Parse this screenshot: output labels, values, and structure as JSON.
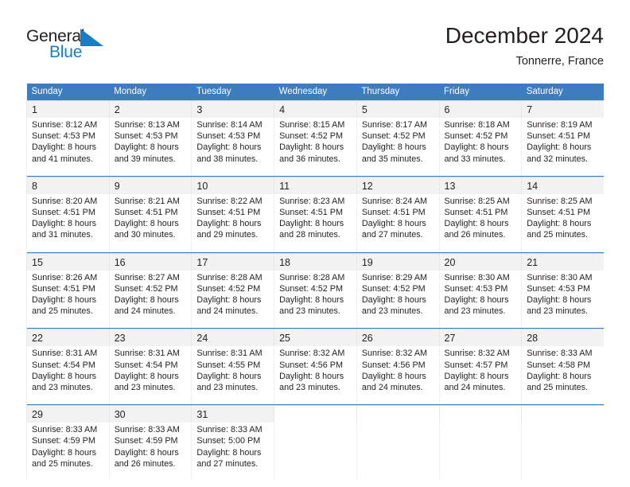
{
  "brand": {
    "name_part1": "General",
    "name_part2": "Blue",
    "flag_color": "#1a7dc4"
  },
  "header": {
    "title": "December 2024",
    "location": "Tonnerre, France"
  },
  "colors": {
    "header_blue": "#3b7dbf",
    "daynum_band": "#f2f2f2",
    "text": "#231f20"
  },
  "weekday_headers": [
    "Sunday",
    "Monday",
    "Tuesday",
    "Wednesday",
    "Thursday",
    "Friday",
    "Saturday"
  ],
  "weeks": [
    {
      "days": [
        {
          "num": "1",
          "sunrise": "Sunrise: 8:12 AM",
          "sunset": "Sunset: 4:53 PM",
          "daylight1": "Daylight: 8 hours",
          "daylight2": "and 41 minutes."
        },
        {
          "num": "2",
          "sunrise": "Sunrise: 8:13 AM",
          "sunset": "Sunset: 4:53 PM",
          "daylight1": "Daylight: 8 hours",
          "daylight2": "and 39 minutes."
        },
        {
          "num": "3",
          "sunrise": "Sunrise: 8:14 AM",
          "sunset": "Sunset: 4:53 PM",
          "daylight1": "Daylight: 8 hours",
          "daylight2": "and 38 minutes."
        },
        {
          "num": "4",
          "sunrise": "Sunrise: 8:15 AM",
          "sunset": "Sunset: 4:52 PM",
          "daylight1": "Daylight: 8 hours",
          "daylight2": "and 36 minutes."
        },
        {
          "num": "5",
          "sunrise": "Sunrise: 8:17 AM",
          "sunset": "Sunset: 4:52 PM",
          "daylight1": "Daylight: 8 hours",
          "daylight2": "and 35 minutes."
        },
        {
          "num": "6",
          "sunrise": "Sunrise: 8:18 AM",
          "sunset": "Sunset: 4:52 PM",
          "daylight1": "Daylight: 8 hours",
          "daylight2": "and 33 minutes."
        },
        {
          "num": "7",
          "sunrise": "Sunrise: 8:19 AM",
          "sunset": "Sunset: 4:51 PM",
          "daylight1": "Daylight: 8 hours",
          "daylight2": "and 32 minutes."
        }
      ]
    },
    {
      "days": [
        {
          "num": "8",
          "sunrise": "Sunrise: 8:20 AM",
          "sunset": "Sunset: 4:51 PM",
          "daylight1": "Daylight: 8 hours",
          "daylight2": "and 31 minutes."
        },
        {
          "num": "9",
          "sunrise": "Sunrise: 8:21 AM",
          "sunset": "Sunset: 4:51 PM",
          "daylight1": "Daylight: 8 hours",
          "daylight2": "and 30 minutes."
        },
        {
          "num": "10",
          "sunrise": "Sunrise: 8:22 AM",
          "sunset": "Sunset: 4:51 PM",
          "daylight1": "Daylight: 8 hours",
          "daylight2": "and 29 minutes."
        },
        {
          "num": "11",
          "sunrise": "Sunrise: 8:23 AM",
          "sunset": "Sunset: 4:51 PM",
          "daylight1": "Daylight: 8 hours",
          "daylight2": "and 28 minutes."
        },
        {
          "num": "12",
          "sunrise": "Sunrise: 8:24 AM",
          "sunset": "Sunset: 4:51 PM",
          "daylight1": "Daylight: 8 hours",
          "daylight2": "and 27 minutes."
        },
        {
          "num": "13",
          "sunrise": "Sunrise: 8:25 AM",
          "sunset": "Sunset: 4:51 PM",
          "daylight1": "Daylight: 8 hours",
          "daylight2": "and 26 minutes."
        },
        {
          "num": "14",
          "sunrise": "Sunrise: 8:25 AM",
          "sunset": "Sunset: 4:51 PM",
          "daylight1": "Daylight: 8 hours",
          "daylight2": "and 25 minutes."
        }
      ]
    },
    {
      "days": [
        {
          "num": "15",
          "sunrise": "Sunrise: 8:26 AM",
          "sunset": "Sunset: 4:51 PM",
          "daylight1": "Daylight: 8 hours",
          "daylight2": "and 25 minutes."
        },
        {
          "num": "16",
          "sunrise": "Sunrise: 8:27 AM",
          "sunset": "Sunset: 4:52 PM",
          "daylight1": "Daylight: 8 hours",
          "daylight2": "and 24 minutes."
        },
        {
          "num": "17",
          "sunrise": "Sunrise: 8:28 AM",
          "sunset": "Sunset: 4:52 PM",
          "daylight1": "Daylight: 8 hours",
          "daylight2": "and 24 minutes."
        },
        {
          "num": "18",
          "sunrise": "Sunrise: 8:28 AM",
          "sunset": "Sunset: 4:52 PM",
          "daylight1": "Daylight: 8 hours",
          "daylight2": "and 23 minutes."
        },
        {
          "num": "19",
          "sunrise": "Sunrise: 8:29 AM",
          "sunset": "Sunset: 4:52 PM",
          "daylight1": "Daylight: 8 hours",
          "daylight2": "and 23 minutes."
        },
        {
          "num": "20",
          "sunrise": "Sunrise: 8:30 AM",
          "sunset": "Sunset: 4:53 PM",
          "daylight1": "Daylight: 8 hours",
          "daylight2": "and 23 minutes."
        },
        {
          "num": "21",
          "sunrise": "Sunrise: 8:30 AM",
          "sunset": "Sunset: 4:53 PM",
          "daylight1": "Daylight: 8 hours",
          "daylight2": "and 23 minutes."
        }
      ]
    },
    {
      "days": [
        {
          "num": "22",
          "sunrise": "Sunrise: 8:31 AM",
          "sunset": "Sunset: 4:54 PM",
          "daylight1": "Daylight: 8 hours",
          "daylight2": "and 23 minutes."
        },
        {
          "num": "23",
          "sunrise": "Sunrise: 8:31 AM",
          "sunset": "Sunset: 4:54 PM",
          "daylight1": "Daylight: 8 hours",
          "daylight2": "and 23 minutes."
        },
        {
          "num": "24",
          "sunrise": "Sunrise: 8:31 AM",
          "sunset": "Sunset: 4:55 PM",
          "daylight1": "Daylight: 8 hours",
          "daylight2": "and 23 minutes."
        },
        {
          "num": "25",
          "sunrise": "Sunrise: 8:32 AM",
          "sunset": "Sunset: 4:56 PM",
          "daylight1": "Daylight: 8 hours",
          "daylight2": "and 23 minutes."
        },
        {
          "num": "26",
          "sunrise": "Sunrise: 8:32 AM",
          "sunset": "Sunset: 4:56 PM",
          "daylight1": "Daylight: 8 hours",
          "daylight2": "and 24 minutes."
        },
        {
          "num": "27",
          "sunrise": "Sunrise: 8:32 AM",
          "sunset": "Sunset: 4:57 PM",
          "daylight1": "Daylight: 8 hours",
          "daylight2": "and 24 minutes."
        },
        {
          "num": "28",
          "sunrise": "Sunrise: 8:33 AM",
          "sunset": "Sunset: 4:58 PM",
          "daylight1": "Daylight: 8 hours",
          "daylight2": "and 25 minutes."
        }
      ]
    },
    {
      "days": [
        {
          "num": "29",
          "sunrise": "Sunrise: 8:33 AM",
          "sunset": "Sunset: 4:59 PM",
          "daylight1": "Daylight: 8 hours",
          "daylight2": "and 25 minutes."
        },
        {
          "num": "30",
          "sunrise": "Sunrise: 8:33 AM",
          "sunset": "Sunset: 4:59 PM",
          "daylight1": "Daylight: 8 hours",
          "daylight2": "and 26 minutes."
        },
        {
          "num": "31",
          "sunrise": "Sunrise: 8:33 AM",
          "sunset": "Sunset: 5:00 PM",
          "daylight1": "Daylight: 8 hours",
          "daylight2": "and 27 minutes."
        },
        {
          "num": "",
          "sunrise": "",
          "sunset": "",
          "daylight1": "",
          "daylight2": ""
        },
        {
          "num": "",
          "sunrise": "",
          "sunset": "",
          "daylight1": "",
          "daylight2": ""
        },
        {
          "num": "",
          "sunrise": "",
          "sunset": "",
          "daylight1": "",
          "daylight2": ""
        },
        {
          "num": "",
          "sunrise": "",
          "sunset": "",
          "daylight1": "",
          "daylight2": ""
        }
      ]
    }
  ]
}
